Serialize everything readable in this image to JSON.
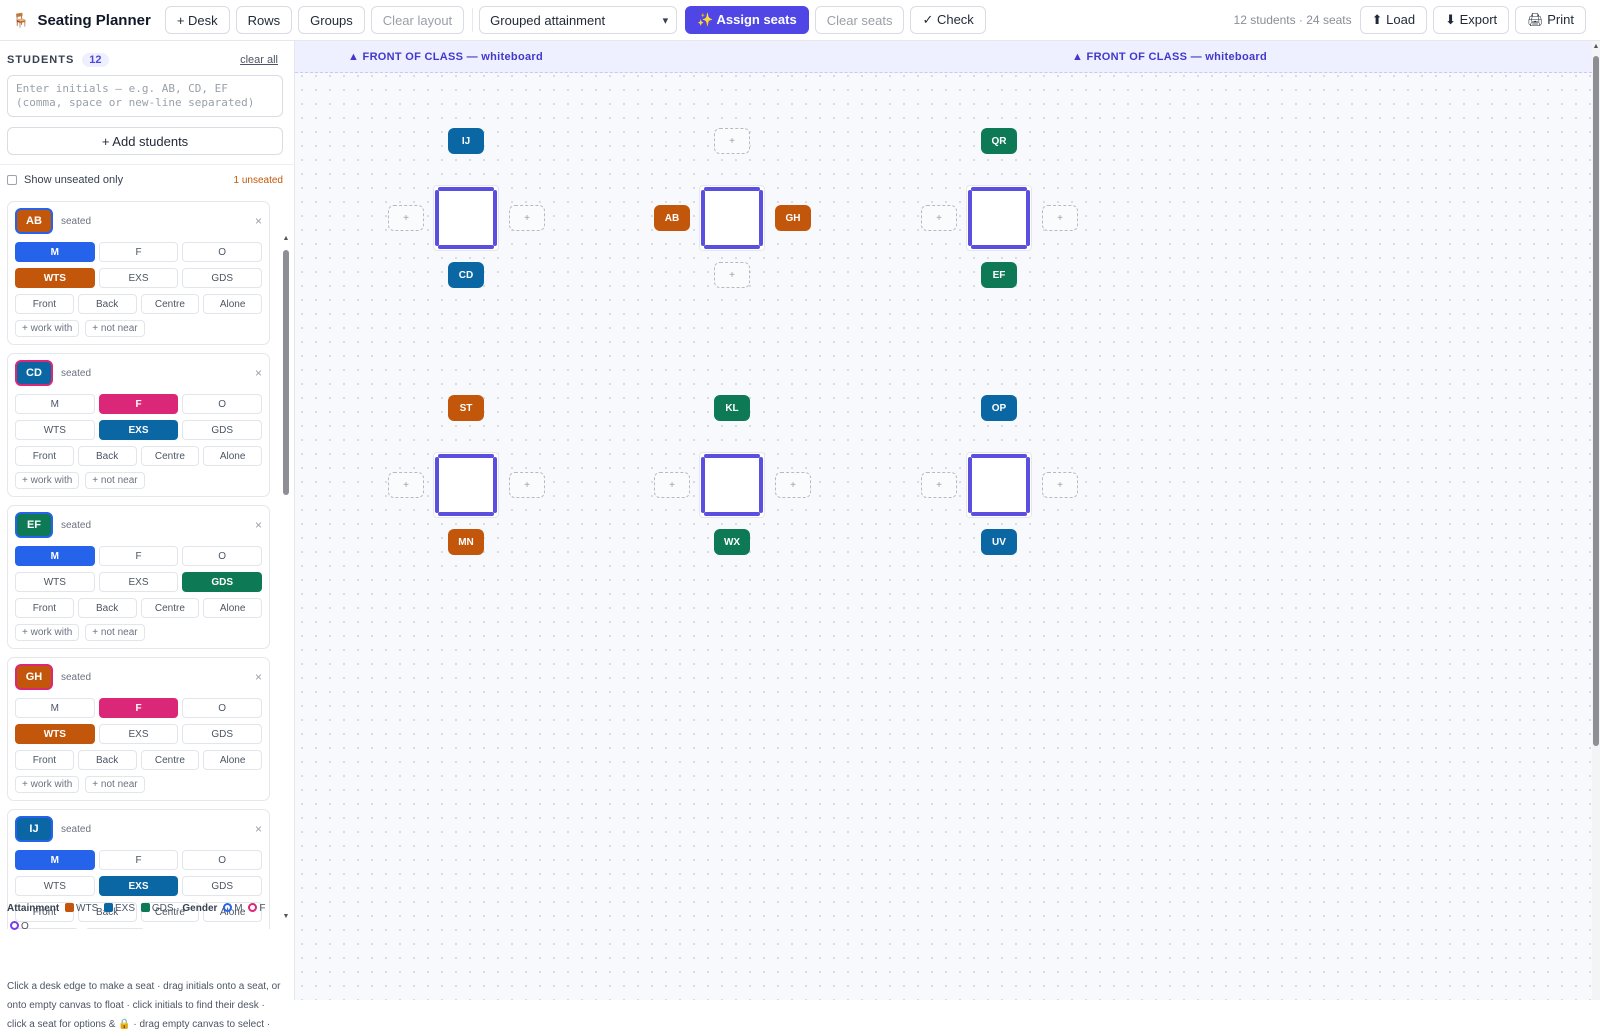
{
  "app": {
    "logo_icon": "🪑",
    "title": "Seating Planner"
  },
  "toolbar": {
    "desk": "+ Desk",
    "rows": "Rows",
    "groups": "Groups",
    "clear_layout": "Clear layout",
    "mode": "Grouped attainment",
    "assign": "✨ Assign seats",
    "clear_seats": "Clear seats",
    "check": "✓ Check",
    "summary": "12 students · 24 seats",
    "load": "⬆ Load",
    "export": "⬇ Export",
    "print": "🖨 Print"
  },
  "sidebar": {
    "title": "STUDENTS",
    "count": "12",
    "clear_all": "clear all",
    "input_placeholder": "Enter initials — e.g. AB, CD, EF\n(comma, space or new-line separated)",
    "add_button": "+ Add students",
    "filter_label": "Show unseated only",
    "unseated": "1 unseated"
  },
  "labels": {
    "gender": [
      "M",
      "F",
      "O"
    ],
    "attainment": [
      "WTS",
      "EXS",
      "GDS"
    ],
    "position": [
      "Front",
      "Back",
      "Centre",
      "Alone"
    ],
    "work_with": "+ work with",
    "not_near": "+ not near",
    "remove": "×",
    "status": "seated"
  },
  "colors": {
    "WTS": "#c2570c",
    "EXS": "#0b67a3",
    "GDS": "#0d7a55",
    "M": "#2563eb",
    "F": "#db2777",
    "O": "#7c3aed",
    "accent": "#4f46e5"
  },
  "students": [
    {
      "initials": "AB",
      "status": "seated",
      "gender": "M",
      "attainment": "WTS"
    },
    {
      "initials": "CD",
      "status": "seated",
      "gender": "F",
      "attainment": "EXS"
    },
    {
      "initials": "EF",
      "status": "seated",
      "gender": "M",
      "attainment": "GDS"
    },
    {
      "initials": "GH",
      "status": "seated",
      "gender": "F",
      "attainment": "WTS"
    },
    {
      "initials": "IJ",
      "status": "seated",
      "gender": "M",
      "attainment": "EXS"
    }
  ],
  "legend": {
    "attainment_label": "Attainment",
    "wts": "WTS",
    "exs": "EXS",
    "gds": "GDS",
    "sep": "·",
    "gender_label": "Gender",
    "m": "M",
    "f": "F",
    "o": "O",
    "help": "Click a desk edge to make a seat · drag initials onto a seat, or onto empty canvas to float · click initials to find their desk · click a seat for options & 🔒 · drag empty canvas to select ·"
  },
  "canvas": {
    "front_label": "▲ FRONT OF CLASS — whiteboard",
    "empty_seat": "+",
    "seats": [
      {
        "initials": "IJ",
        "att": "EXS"
      },
      {
        "initials": "CD",
        "att": "EXS"
      },
      {
        "initials": "AB",
        "att": "WTS"
      },
      {
        "initials": "GH",
        "att": "WTS"
      },
      {
        "initials": "QR",
        "att": "GDS"
      },
      {
        "initials": "EF",
        "att": "GDS"
      },
      {
        "initials": "ST",
        "att": "WTS"
      },
      {
        "initials": "MN",
        "att": "WTS"
      },
      {
        "initials": "KL",
        "att": "GDS"
      },
      {
        "initials": "WX",
        "att": "GDS"
      },
      {
        "initials": "OP",
        "att": "EXS"
      },
      {
        "initials": "UV",
        "att": "EXS"
      }
    ]
  }
}
